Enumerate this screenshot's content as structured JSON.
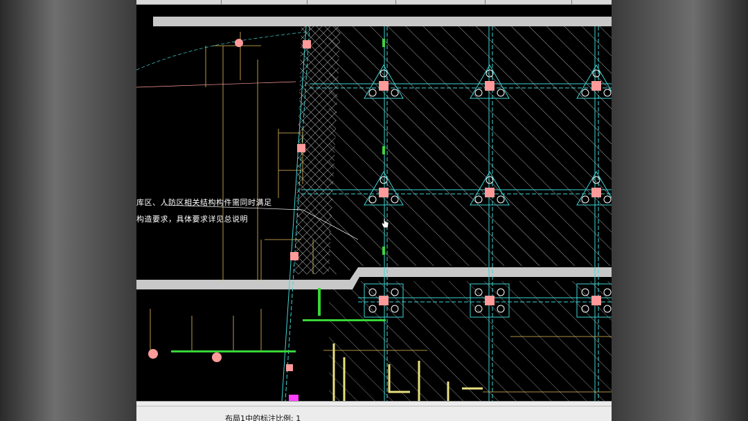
{
  "drawing": {
    "note_line_1": "库区、人防区相关结构构件需同时满足",
    "note_line_2": "构造要求，具体要求详见总说明"
  },
  "status_bar": {
    "scale_label": "布局1中的标注比例: 1"
  },
  "colors": {
    "background": "#000000",
    "slab_band": "#c8c8c8",
    "column": "#ff9a9a",
    "grid_line": "#3fd6d6",
    "dimension": "#e8c060",
    "beam": "#ffffff",
    "green_line": "#39d539",
    "status_bg": "#ececec"
  },
  "icons": {
    "cursor": "hand-cursor-icon"
  }
}
